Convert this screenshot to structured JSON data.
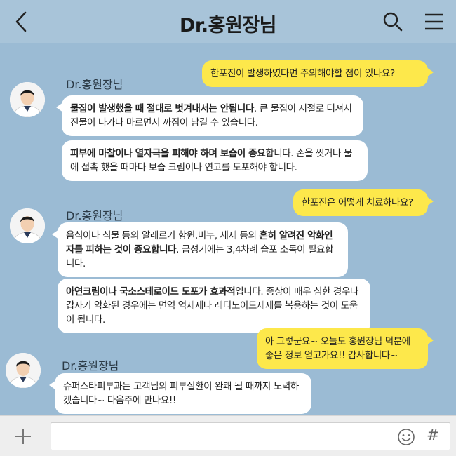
{
  "header": {
    "title": "Dr.홍원장님",
    "back_icon": "chevron-left-icon",
    "search_icon": "search-icon",
    "menu_icon": "hamburger-menu-icon"
  },
  "messages": [
    {
      "dir": "out",
      "text": "한포진이 발생하였다면 주의해야할 점이 있나요?"
    },
    {
      "dir": "in",
      "sender": "Dr.홍원장님",
      "segments": [
        {
          "t": "물집이 발생했을 때 절대로 벗겨내서는 안됩니다",
          "b": true
        },
        {
          "t": ". 큰 물집이 저절로 터져서 진물이 나가나 마르면서 까짐이 남길 수 있습니다.",
          "b": false
        }
      ]
    },
    {
      "dir": "in",
      "segments": [
        {
          "t": "피부에 마찰이나 열자극을 피해야 하며 보습이 중요",
          "b": true
        },
        {
          "t": "합니다. 손을 씻거나 물에 접촉 했을 때마다 보습 크림이나 연고를 도포해야 합니다.",
          "b": false
        }
      ]
    },
    {
      "dir": "out",
      "text": "한포진은 어떻게 치료하나요?"
    },
    {
      "dir": "in",
      "sender": "Dr.홍원장님",
      "segments": [
        {
          "t": "음식이나 식물 등의 알레르기 항원,비누, 세제 등의 ",
          "b": false
        },
        {
          "t": "흔히 알려진 악화인자를 피하는 것이 중요합니다",
          "b": true
        },
        {
          "t": ". 급성기에는 3,4차례 습포 소독이 필요합니다.",
          "b": false
        }
      ]
    },
    {
      "dir": "in",
      "segments": [
        {
          "t": "아연크림이나 국소스테로이드 도포가 효과적",
          "b": true
        },
        {
          "t": "입니다. 증상이 매우 심한 경우나 갑자기 악화된 경우에는 면역 억제제나 레티노이드제제를 복용하는 것이 도움이 됩니다.",
          "b": false
        }
      ]
    },
    {
      "dir": "out",
      "text": "아 그렇군요~ 오늘도 홍원장님 덕분에 좋은 정보 얻고가요!! 감사합니다~"
    },
    {
      "dir": "in",
      "sender": "Dr.홍원장님",
      "segments": [
        {
          "t": "슈퍼스타피부과는 고객님의 피부질환이 완쾌 될 때까지 노력하겠습니다~ 다음주에 만나요!!",
          "b": false
        }
      ]
    }
  ],
  "composer": {
    "placeholder": "",
    "value": "",
    "plus_icon": "plus-icon",
    "emoji_icon": "smiley-icon",
    "hash_label": "#"
  },
  "colors": {
    "background": "#9bbbd4",
    "outgoing_bubble": "#fde84b",
    "incoming_bubble": "#ffffff"
  }
}
